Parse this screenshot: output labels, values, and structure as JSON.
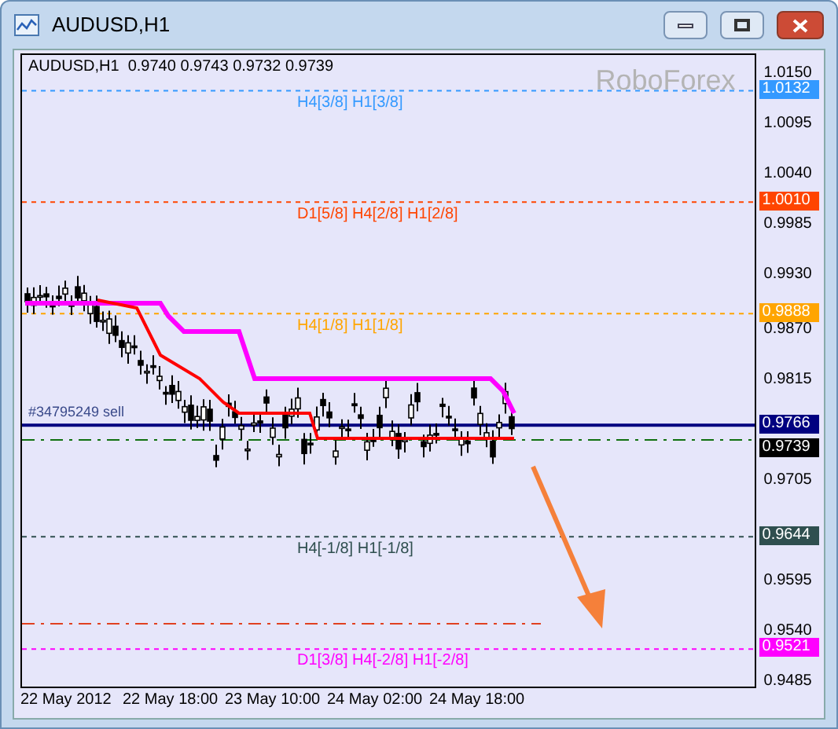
{
  "window": {
    "title": "AUDUSD,H1"
  },
  "chart": {
    "header": "AUDUSD,H1  0.9740 0.9743 0.9732 0.9739",
    "watermark": "RoboForex",
    "order_label": "#34795249 sell",
    "levels": [
      {
        "kind": "level",
        "label": "H4[3/8] H1[3/8]",
        "tag": "1.0132",
        "color": "#3399ff"
      },
      {
        "kind": "level",
        "label": "D1[5/8] H4[2/8] H1[2/8]",
        "tag": "1.0010",
        "color": "#ff4500"
      },
      {
        "kind": "level",
        "label": "H4[1/8] H1[1/8]",
        "tag": "0.9888",
        "color": "#ffa500"
      },
      {
        "kind": "line",
        "tag": "0.9766",
        "color": "#000080"
      },
      {
        "kind": "bid",
        "tag": "0.9739",
        "color": "#000000"
      },
      {
        "kind": "level",
        "label": "H4[-1/8] H1[-1/8]",
        "tag": "0.9644",
        "color": "#2f4f4f"
      },
      {
        "kind": "level",
        "label": "D1[3/8] H4[-2/8] H1[-2/8]",
        "tag": "0.9521",
        "color": "#ff00ff"
      }
    ],
    "yticks": [
      "1.0150",
      "1.0095",
      "1.0040",
      "0.9985",
      "0.9930",
      "0.9870",
      "0.9815",
      "0.9705",
      "0.9595",
      "0.9540",
      "0.9485"
    ],
    "xticks": [
      "22 May 2012",
      "22 May 18:00",
      "23 May 10:00",
      "24 May 02:00",
      "24 May 18:00"
    ]
  }
}
